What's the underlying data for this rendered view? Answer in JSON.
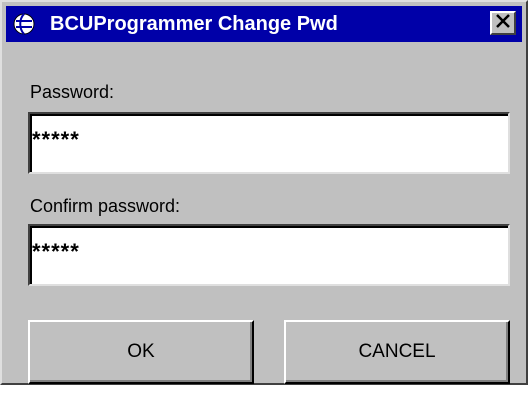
{
  "window": {
    "title": "BCUProgrammer Change Pwd",
    "icon": "app-globe-icon",
    "close_icon": "close-icon"
  },
  "form": {
    "password_label": "Password:",
    "password_value": "*****",
    "confirm_label": "Confirm password:",
    "confirm_value": "*****"
  },
  "buttons": {
    "ok_label": "OK",
    "cancel_label": "CANCEL"
  },
  "colors": {
    "titlebar": "#0000a8",
    "dialog_bg": "#c0c0c0"
  }
}
